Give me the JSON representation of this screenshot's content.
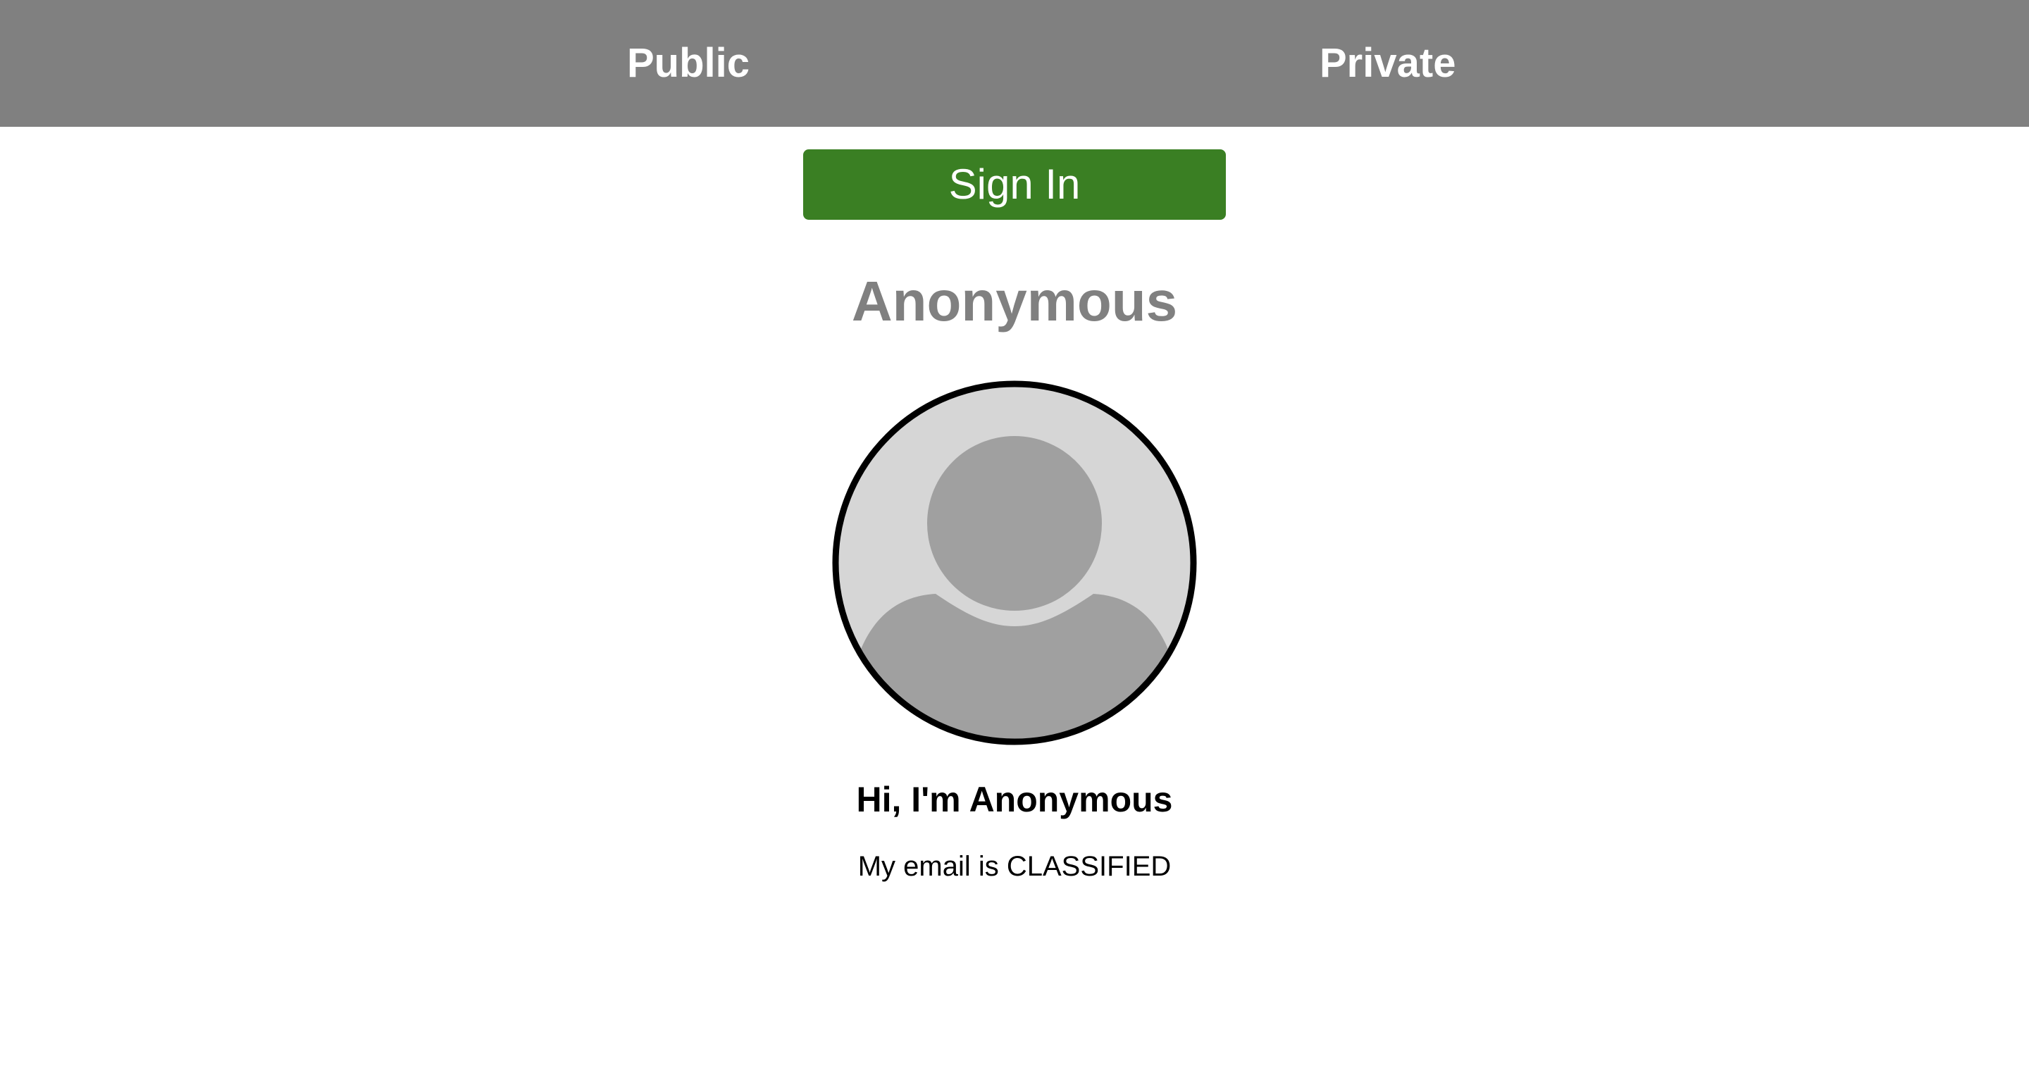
{
  "nav": {
    "items": [
      {
        "label": "Public"
      },
      {
        "label": "Private"
      }
    ],
    "background_color": "#808080",
    "text_color": "#ffffff"
  },
  "auth": {
    "sign_in_label": "Sign In",
    "button_color": "#3a7f23"
  },
  "profile": {
    "name_heading": "Anonymous",
    "avatar_icon": "default-user-avatar-icon",
    "greeting": "Hi, I'm Anonymous",
    "email_text": "My email is CLASSIFIED"
  }
}
